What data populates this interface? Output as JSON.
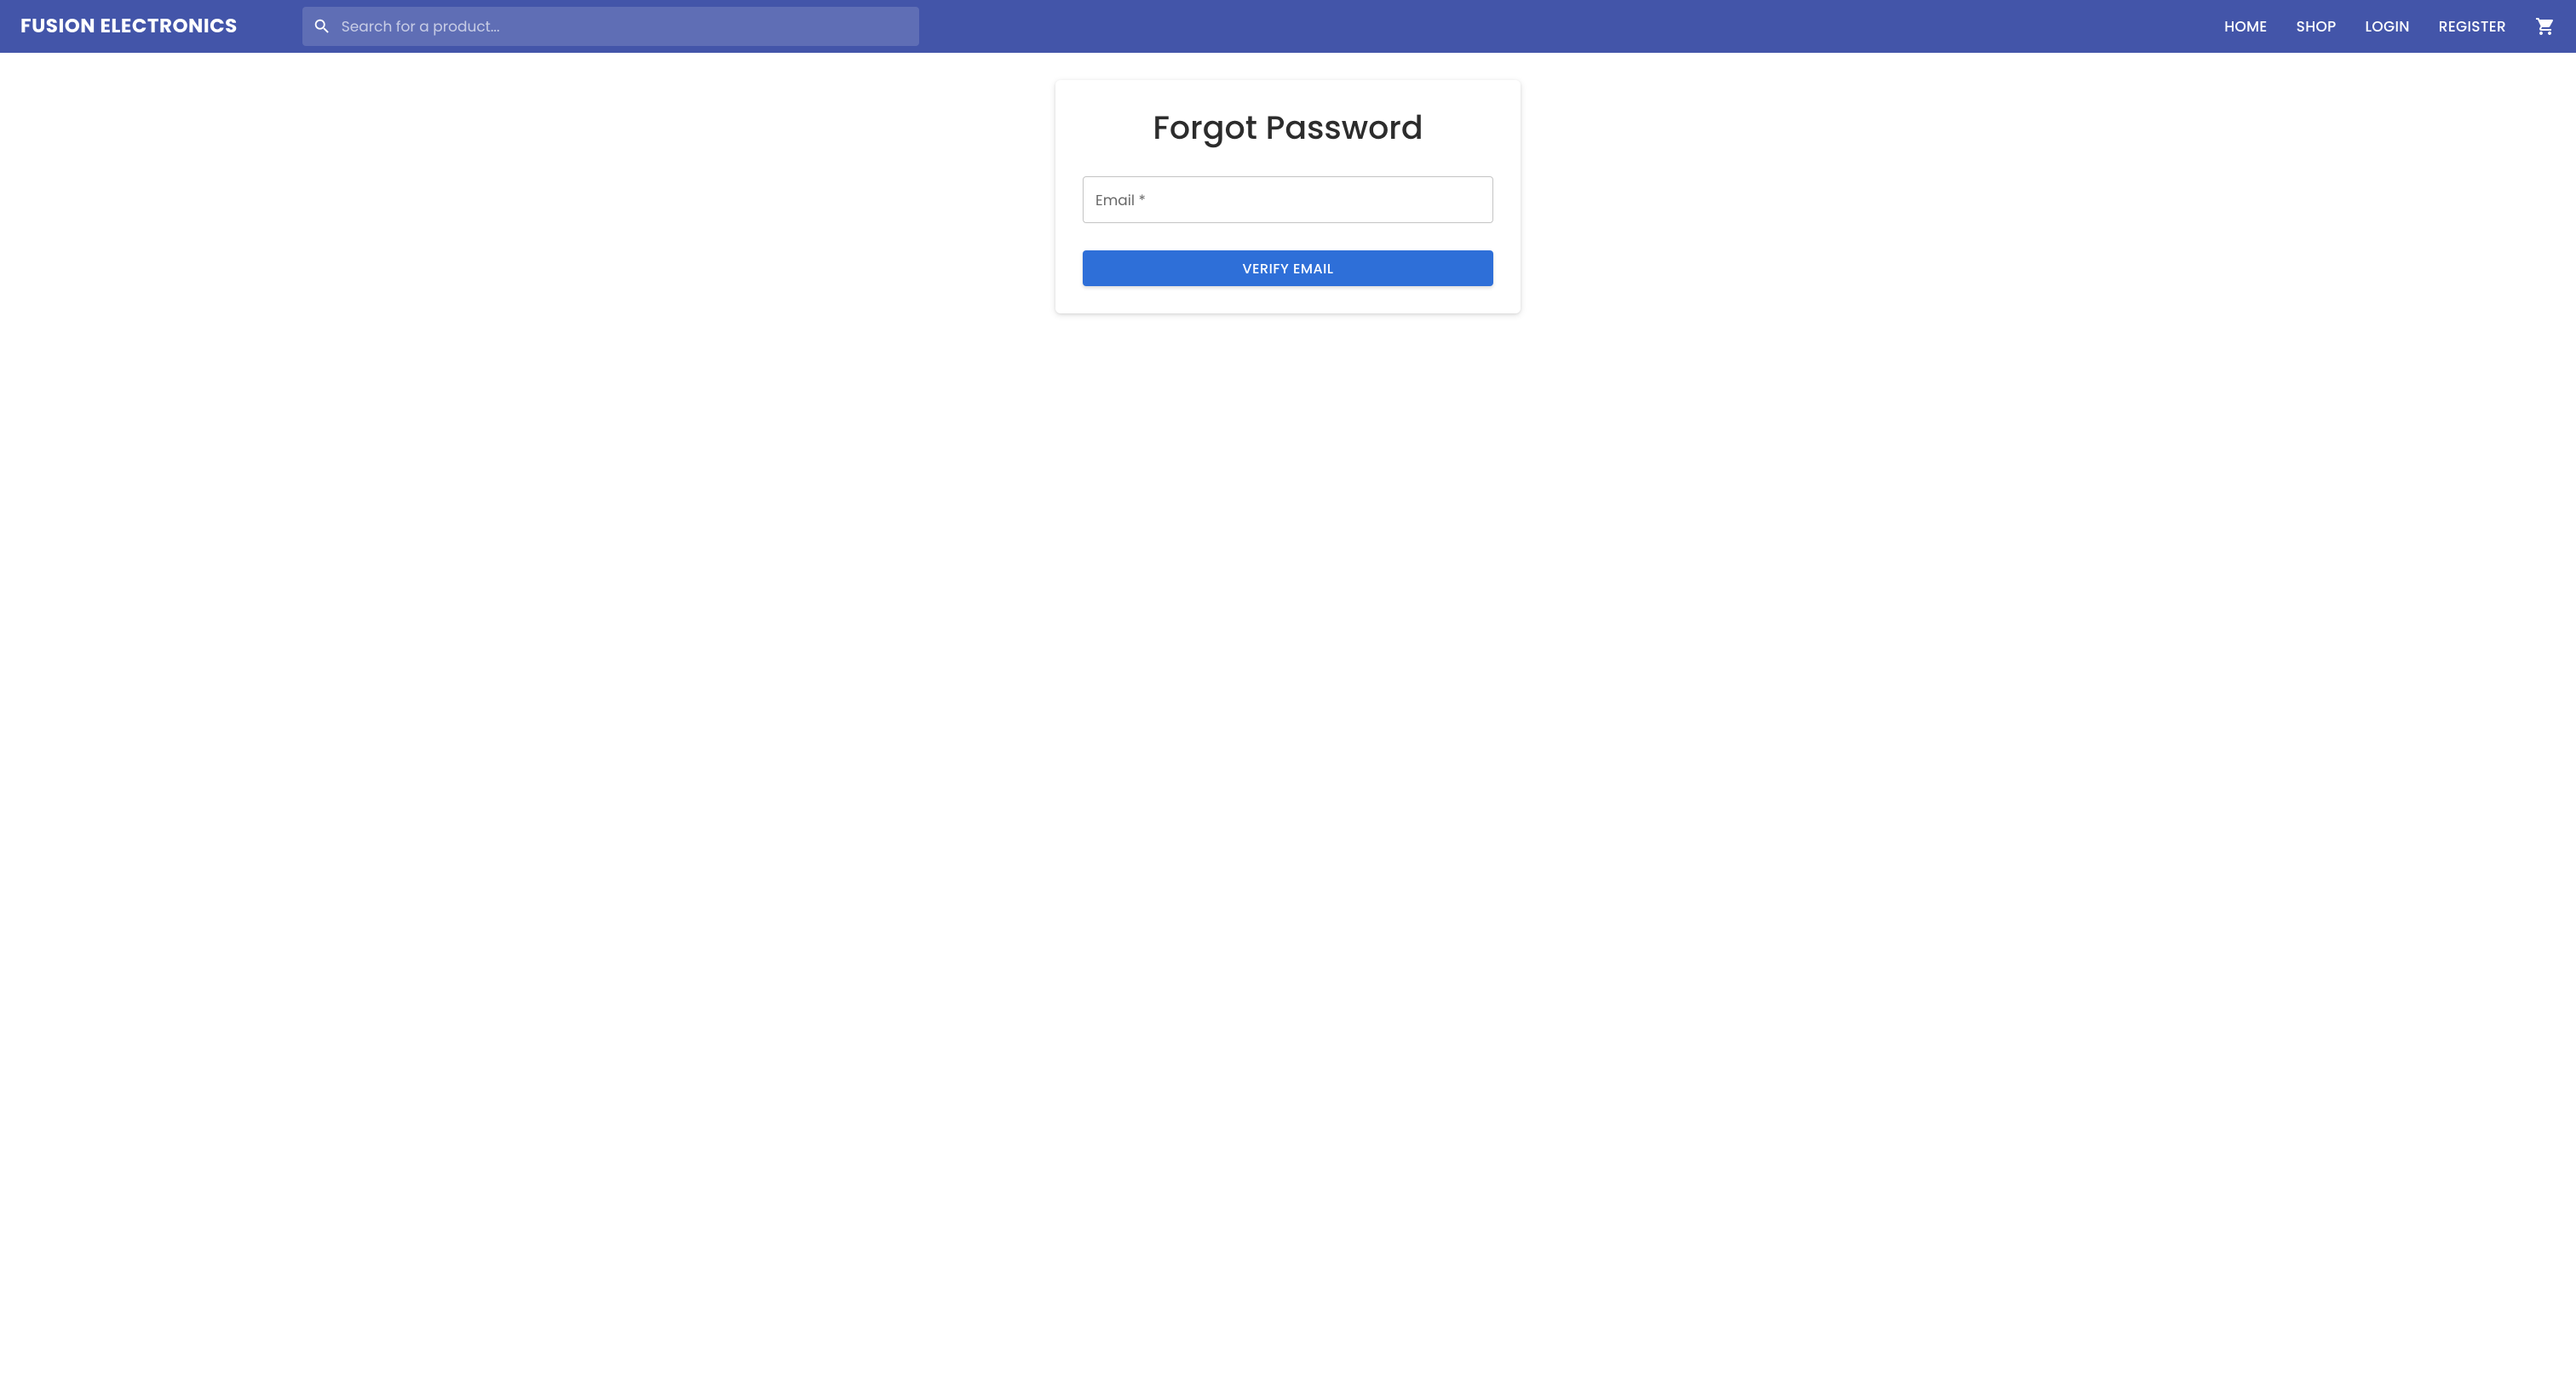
{
  "header": {
    "brand": "FUSION ELECTRONICS",
    "search_placeholder": "Search for a product...",
    "nav": {
      "home": "HOME",
      "shop": "SHOP",
      "login": "LOGIN",
      "register": "REGISTER"
    }
  },
  "card": {
    "title": "Forgot Password",
    "email_label": "Email *",
    "verify_button": "VERIFY EMAIL"
  }
}
